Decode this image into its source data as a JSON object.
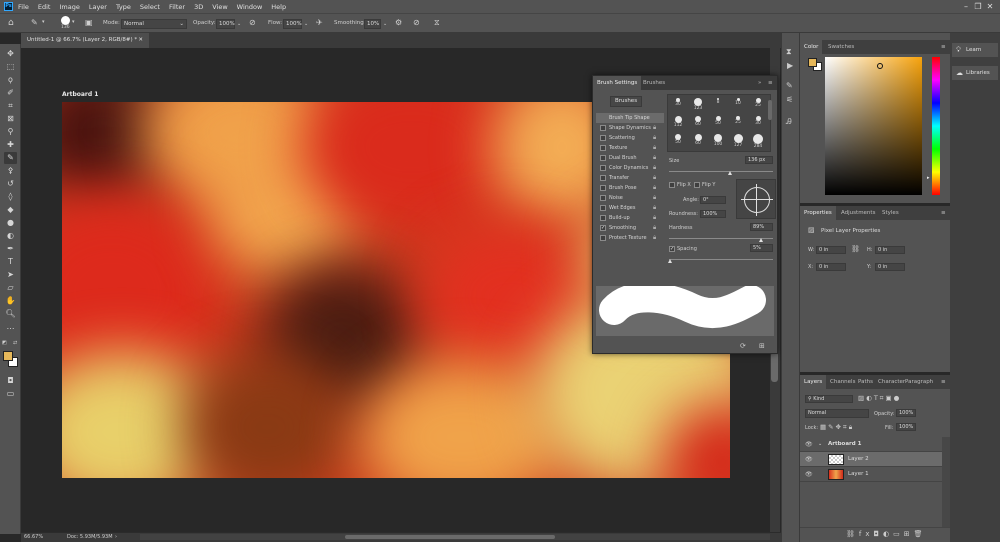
{
  "menu": {
    "items": [
      "File",
      "Edit",
      "Image",
      "Layer",
      "Type",
      "Select",
      "Filter",
      "3D",
      "View",
      "Window",
      "Help"
    ]
  },
  "options": {
    "brush_size": "136",
    "mode_label": "Mode:",
    "mode_value": "Normal",
    "opacity_label": "Opacity:",
    "opacity_value": "100%",
    "flow_label": "Flow:",
    "flow_value": "100%",
    "smoothing_label": "Smoothing:",
    "smoothing_value": "10%"
  },
  "document": {
    "tab_title": "Untitled-1 @ 66.7% (Layer 2, RGB/8#) *",
    "artboard_label": "Artboard 1",
    "zoom": "66.67%",
    "doc_info": "Doc: 5.93M/5.93M"
  },
  "brush_settings": {
    "tabs": [
      "Brush Settings",
      "Brushes"
    ],
    "brushes_button": "Brushes",
    "items": [
      {
        "label": "Brush Tip Shape",
        "checkbox": false,
        "lock": false,
        "selected": true
      },
      {
        "label": "Shape Dynamics",
        "checkbox": true,
        "checked": false,
        "lock": true
      },
      {
        "label": "Scattering",
        "checkbox": true,
        "checked": false,
        "lock": true
      },
      {
        "label": "Texture",
        "checkbox": true,
        "checked": false,
        "lock": true
      },
      {
        "label": "Dual Brush",
        "checkbox": true,
        "checked": false,
        "lock": true
      },
      {
        "label": "Color Dynamics",
        "checkbox": true,
        "checked": false,
        "lock": true
      },
      {
        "label": "Transfer",
        "checkbox": true,
        "checked": false,
        "lock": true
      },
      {
        "label": "Brush Pose",
        "checkbox": true,
        "checked": false,
        "lock": true
      },
      {
        "label": "Noise",
        "checkbox": true,
        "checked": false,
        "lock": true
      },
      {
        "label": "Wet Edges",
        "checkbox": true,
        "checked": false,
        "lock": true
      },
      {
        "label": "Build-up",
        "checkbox": true,
        "checked": false,
        "lock": true
      },
      {
        "label": "Smoothing",
        "checkbox": true,
        "checked": true,
        "lock": true
      },
      {
        "label": "Protect Texture",
        "checkbox": true,
        "checked": false,
        "lock": true
      }
    ],
    "tip_sizes": [
      "30",
      "123",
      "8",
      "10",
      "25",
      "112",
      "60",
      "50",
      "25",
      "30",
      "50",
      "60",
      "100",
      "127",
      "284"
    ],
    "size_label": "Size",
    "size_value": "136 px",
    "flipx": "Flip X",
    "flipy": "Flip Y",
    "angle_label": "Angle:",
    "angle_value": "0°",
    "roundness_label": "Roundness:",
    "roundness_value": "100%",
    "hardness_label": "Hardness",
    "hardness_value": "89%",
    "spacing_label": "Spacing",
    "spacing_value": "5%"
  },
  "color_panel": {
    "tabs": [
      "Color",
      "Swatches"
    ],
    "fg": "#e6b85a"
  },
  "properties": {
    "tabs": [
      "Properties",
      "Adjustments",
      "Styles"
    ],
    "title": "Pixel Layer Properties",
    "w_label": "W:",
    "w_value": "0 in",
    "h_label": "H:",
    "h_value": "0 in",
    "x_label": "X:",
    "x_value": "0 in",
    "y_label": "Y:",
    "y_value": "0 in",
    "link_icon": "link-icon"
  },
  "layers": {
    "tabs": [
      "Layers",
      "Channels",
      "Paths",
      "Character",
      "Paragraph"
    ],
    "kind": "Kind",
    "blend": "Normal",
    "opacity_label": "Opacity:",
    "opacity_value": "100%",
    "lock_label": "Lock:",
    "fill_label": "Fill:",
    "fill_value": "100%",
    "rows": [
      {
        "name": "Artboard 1"
      },
      {
        "name": "Layer 2"
      },
      {
        "name": "Layer 1"
      }
    ]
  },
  "learn": {
    "items": [
      "Learn",
      "Libraries"
    ]
  }
}
